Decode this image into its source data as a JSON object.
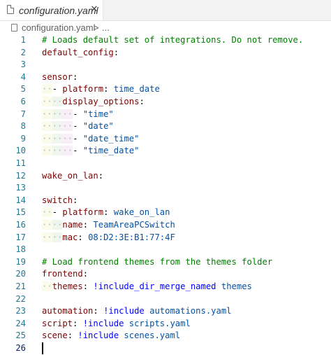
{
  "tab": {
    "filename": "configuration.yaml",
    "close_glyph": "✕"
  },
  "breadcrumb": {
    "file": "configuration.yaml",
    "separator": ">",
    "more": "..."
  },
  "editor": {
    "lines": [
      {
        "num": "1",
        "guides": [],
        "tokens": [
          {
            "t": "# Loads default set of integrations. Do not remove.",
            "c": "c"
          }
        ]
      },
      {
        "num": "2",
        "guides": [],
        "tokens": [
          {
            "t": "default_config",
            "c": "k"
          },
          {
            "t": ":",
            "c": "p"
          }
        ]
      },
      {
        "num": "3",
        "guides": [],
        "tokens": []
      },
      {
        "num": "4",
        "guides": [],
        "tokens": [
          {
            "t": "sensor",
            "c": "k"
          },
          {
            "t": ":",
            "c": "p"
          }
        ]
      },
      {
        "num": "5",
        "guides": [
          "··"
        ],
        "tokens": [
          {
            "t": "- ",
            "c": "p"
          },
          {
            "t": "platform",
            "c": "k"
          },
          {
            "t": ": ",
            "c": "p"
          },
          {
            "t": "time_date",
            "c": "s"
          }
        ]
      },
      {
        "num": "6",
        "guides": [
          "··",
          "··"
        ],
        "tokens": [
          {
            "t": "display_options",
            "c": "k"
          },
          {
            "t": ":",
            "c": "p"
          }
        ]
      },
      {
        "num": "7",
        "guides": [
          "··",
          "··",
          "··"
        ],
        "tokens": [
          {
            "t": "- ",
            "c": "p"
          },
          {
            "t": "\"time\"",
            "c": "s"
          }
        ]
      },
      {
        "num": "8",
        "guides": [
          "··",
          "··",
          "··"
        ],
        "tokens": [
          {
            "t": "- ",
            "c": "p"
          },
          {
            "t": "\"date\"",
            "c": "s"
          }
        ]
      },
      {
        "num": "9",
        "guides": [
          "··",
          "··",
          "··"
        ],
        "tokens": [
          {
            "t": "- ",
            "c": "p"
          },
          {
            "t": "\"date_time\"",
            "c": "s"
          }
        ]
      },
      {
        "num": "10",
        "guides": [
          "··",
          "··",
          "··"
        ],
        "tokens": [
          {
            "t": "- ",
            "c": "p"
          },
          {
            "t": "\"time_date\"",
            "c": "s"
          }
        ]
      },
      {
        "num": "11",
        "guides": [],
        "tokens": []
      },
      {
        "num": "12",
        "guides": [],
        "tokens": [
          {
            "t": "wake_on_lan",
            "c": "k"
          },
          {
            "t": ":",
            "c": "p"
          }
        ]
      },
      {
        "num": "13",
        "guides": [],
        "tokens": []
      },
      {
        "num": "14",
        "guides": [],
        "tokens": [
          {
            "t": "switch",
            "c": "k"
          },
          {
            "t": ":",
            "c": "p"
          }
        ]
      },
      {
        "num": "15",
        "guides": [
          "··"
        ],
        "tokens": [
          {
            "t": "- ",
            "c": "p"
          },
          {
            "t": "platform",
            "c": "k"
          },
          {
            "t": ": ",
            "c": "p"
          },
          {
            "t": "wake_on_lan",
            "c": "s"
          }
        ]
      },
      {
        "num": "16",
        "guides": [
          "··",
          "··"
        ],
        "tokens": [
          {
            "t": "name",
            "c": "k"
          },
          {
            "t": ": ",
            "c": "p"
          },
          {
            "t": "TeamAreaPCSwitch",
            "c": "s"
          }
        ]
      },
      {
        "num": "17",
        "guides": [
          "··",
          "··"
        ],
        "tokens": [
          {
            "t": "mac",
            "c": "k"
          },
          {
            "t": ": ",
            "c": "p"
          },
          {
            "t": "08:D2:3E:B1:77:4F",
            "c": "s"
          }
        ]
      },
      {
        "num": "18",
        "guides": [],
        "tokens": []
      },
      {
        "num": "19",
        "guides": [],
        "tokens": [
          {
            "t": "# Load frontend themes from the themes folder",
            "c": "c"
          }
        ]
      },
      {
        "num": "20",
        "guides": [],
        "tokens": [
          {
            "t": "frontend",
            "c": "k"
          },
          {
            "t": ":",
            "c": "p"
          }
        ]
      },
      {
        "num": "21",
        "guides": [
          "··"
        ],
        "tokens": [
          {
            "t": "themes",
            "c": "k"
          },
          {
            "t": ": ",
            "c": "p"
          },
          {
            "t": "!include_dir_merge_named",
            "c": "t"
          },
          {
            "t": " themes",
            "c": "s"
          }
        ]
      },
      {
        "num": "22",
        "guides": [],
        "tokens": []
      },
      {
        "num": "23",
        "guides": [],
        "tokens": [
          {
            "t": "automation",
            "c": "k"
          },
          {
            "t": ": ",
            "c": "p"
          },
          {
            "t": "!include",
            "c": "t"
          },
          {
            "t": " automations.yaml",
            "c": "s"
          }
        ]
      },
      {
        "num": "24",
        "guides": [],
        "tokens": [
          {
            "t": "script",
            "c": "k"
          },
          {
            "t": ": ",
            "c": "p"
          },
          {
            "t": "!include",
            "c": "t"
          },
          {
            "t": " scripts.yaml",
            "c": "s"
          }
        ]
      },
      {
        "num": "25",
        "guides": [],
        "tokens": [
          {
            "t": "scene",
            "c": "k"
          },
          {
            "t": ": ",
            "c": "p"
          },
          {
            "t": "!include",
            "c": "t"
          },
          {
            "t": " scenes.yaml",
            "c": "s"
          }
        ]
      },
      {
        "num": "26",
        "guides": [],
        "tokens": [],
        "active": true
      }
    ]
  },
  "colors": {
    "comment": "#008000",
    "key": "#800000",
    "string": "#0451a5",
    "tag": "#0000ff",
    "line_number": "#237893"
  }
}
